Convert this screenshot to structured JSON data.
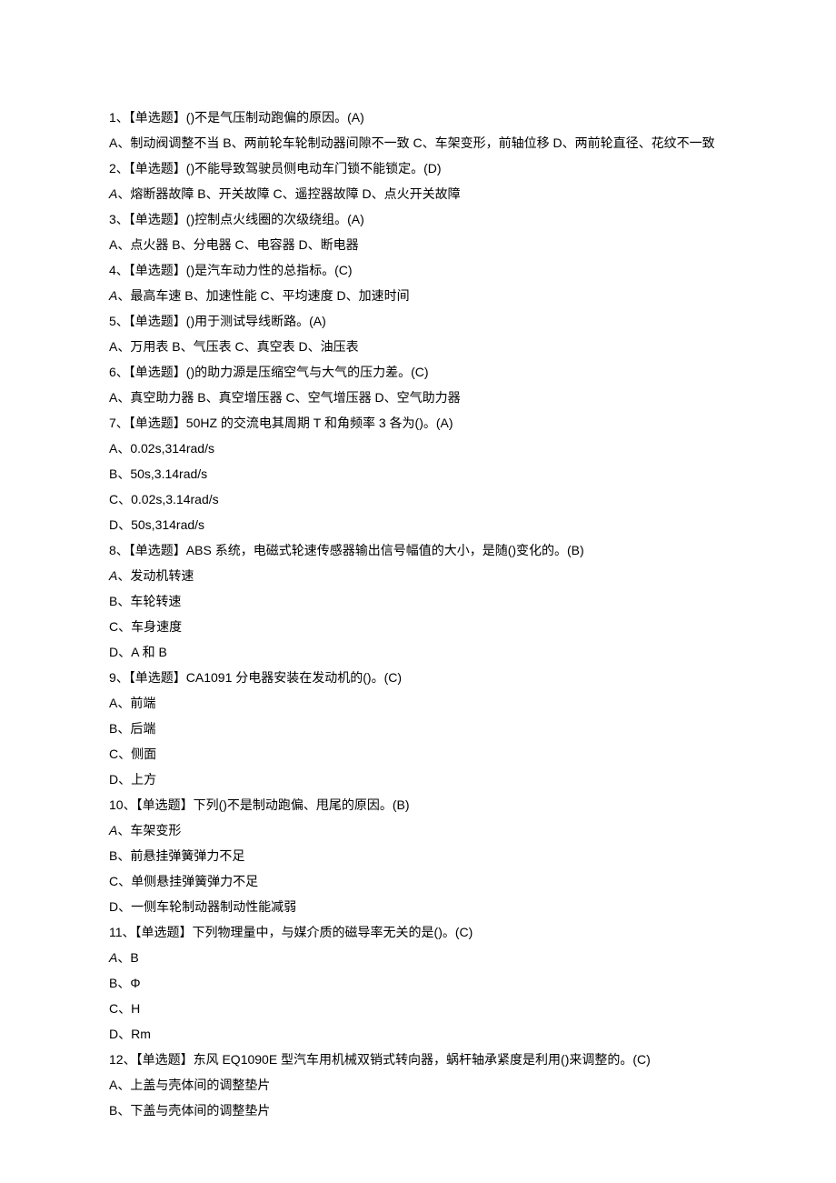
{
  "questions": [
    {
      "stem": "1、【单选题】()不是气压制动跑偏的原因。(A)",
      "options_inline": "A、制动阀调整不当 B、两前轮车轮制动器间隙不一致 C、车架变形，前轴位移 D、两前轮直径、花纹不一致"
    },
    {
      "stem": "2、【单选题】()不能导致驾驶员侧电动车门锁不能锁定。(D)",
      "options_inline_italic_a": "、熔断器故障 B、开关故障 C、遥控器故障 D、点火开关故障"
    },
    {
      "stem": "3、【单选题】()控制点火线圈的次级绕组。(A)",
      "options_inline": "A、点火器 B、分电器 C、电容器 D、断电器"
    },
    {
      "stem": "4、【单选题】()是汽车动力性的总指标。(C)",
      "options_inline_italic_a": "、最高车速 B、加速性能 C、平均速度 D、加速时间"
    },
    {
      "stem": "5、【单选题】()用于测试导线断路。(A)",
      "options_inline": "A、万用表 B、气压表 C、真空表 D、油压表"
    },
    {
      "stem": "6、【单选题】()的助力源是压缩空气与大气的压力差。(C)",
      "options_inline": "A、真空助力器 B、真空增压器 C、空气增压器 D、空气助力器"
    },
    {
      "stem": "7、【单选题】50HZ 的交流电其周期 T 和角频率 3 各为()。(A)",
      "options": [
        "A、0.02s,314rad/s",
        "B、50s,3.14rad/s",
        "C、0.02s,3.14rad/s",
        "D、50s,314rad/s"
      ]
    },
    {
      "stem": "8、【单选题】ABS 系统，电磁式轮速传感器输出信号幅值的大小，是随()变化的。(B)",
      "options_italic_a_first": "、发动机转速",
      "options": [
        "B、车轮转速",
        "C、车身速度",
        "D、A 和 B"
      ]
    },
    {
      "stem": "9、【单选题】CA1091 分电器安装在发动机的()。(C)",
      "options": [
        "A、前端",
        "B、后端",
        "C、侧面",
        "D、上方"
      ]
    },
    {
      "stem": "10、【单选题】下列()不是制动跑偏、甩尾的原因。(B)",
      "options_italic_a_first": "、车架变形",
      "options": [
        "B、前悬挂弹簧弹力不足",
        "C、单侧悬挂弹簧弹力不足",
        "D、一侧车轮制动器制动性能减弱"
      ]
    },
    {
      "stem": "11、【单选题】下列物理量中，与媒介质的磁导率无关的是()。(C)",
      "options_italic_a_first": "、B",
      "options": [
        "B、Φ",
        "C、H",
        "D、Rm"
      ]
    },
    {
      "stem": "12、【单选题】东风 EQ1090E 型汽车用机械双销式转向器，蜗杆轴承紧度是利用()来调整的。(C)",
      "options": [
        "A、上盖与壳体间的调整垫片",
        "B、下盖与壳体间的调整垫片"
      ]
    }
  ]
}
